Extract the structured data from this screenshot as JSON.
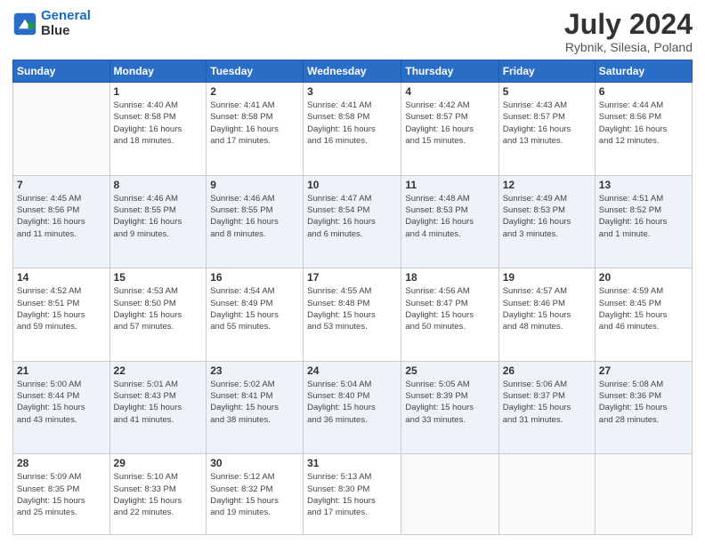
{
  "logo": {
    "line1": "General",
    "line2": "Blue"
  },
  "title": "July 2024",
  "subtitle": "Rybnik, Silesia, Poland",
  "header_days": [
    "Sunday",
    "Monday",
    "Tuesday",
    "Wednesday",
    "Thursday",
    "Friday",
    "Saturday"
  ],
  "weeks": [
    [
      {
        "day": "",
        "info": ""
      },
      {
        "day": "1",
        "info": "Sunrise: 4:40 AM\nSunset: 8:58 PM\nDaylight: 16 hours\nand 18 minutes."
      },
      {
        "day": "2",
        "info": "Sunrise: 4:41 AM\nSunset: 8:58 PM\nDaylight: 16 hours\nand 17 minutes."
      },
      {
        "day": "3",
        "info": "Sunrise: 4:41 AM\nSunset: 8:58 PM\nDaylight: 16 hours\nand 16 minutes."
      },
      {
        "day": "4",
        "info": "Sunrise: 4:42 AM\nSunset: 8:57 PM\nDaylight: 16 hours\nand 15 minutes."
      },
      {
        "day": "5",
        "info": "Sunrise: 4:43 AM\nSunset: 8:57 PM\nDaylight: 16 hours\nand 13 minutes."
      },
      {
        "day": "6",
        "info": "Sunrise: 4:44 AM\nSunset: 8:56 PM\nDaylight: 16 hours\nand 12 minutes."
      }
    ],
    [
      {
        "day": "7",
        "info": "Sunrise: 4:45 AM\nSunset: 8:56 PM\nDaylight: 16 hours\nand 11 minutes."
      },
      {
        "day": "8",
        "info": "Sunrise: 4:46 AM\nSunset: 8:55 PM\nDaylight: 16 hours\nand 9 minutes."
      },
      {
        "day": "9",
        "info": "Sunrise: 4:46 AM\nSunset: 8:55 PM\nDaylight: 16 hours\nand 8 minutes."
      },
      {
        "day": "10",
        "info": "Sunrise: 4:47 AM\nSunset: 8:54 PM\nDaylight: 16 hours\nand 6 minutes."
      },
      {
        "day": "11",
        "info": "Sunrise: 4:48 AM\nSunset: 8:53 PM\nDaylight: 16 hours\nand 4 minutes."
      },
      {
        "day": "12",
        "info": "Sunrise: 4:49 AM\nSunset: 8:53 PM\nDaylight: 16 hours\nand 3 minutes."
      },
      {
        "day": "13",
        "info": "Sunrise: 4:51 AM\nSunset: 8:52 PM\nDaylight: 16 hours\nand 1 minute."
      }
    ],
    [
      {
        "day": "14",
        "info": "Sunrise: 4:52 AM\nSunset: 8:51 PM\nDaylight: 15 hours\nand 59 minutes."
      },
      {
        "day": "15",
        "info": "Sunrise: 4:53 AM\nSunset: 8:50 PM\nDaylight: 15 hours\nand 57 minutes."
      },
      {
        "day": "16",
        "info": "Sunrise: 4:54 AM\nSunset: 8:49 PM\nDaylight: 15 hours\nand 55 minutes."
      },
      {
        "day": "17",
        "info": "Sunrise: 4:55 AM\nSunset: 8:48 PM\nDaylight: 15 hours\nand 53 minutes."
      },
      {
        "day": "18",
        "info": "Sunrise: 4:56 AM\nSunset: 8:47 PM\nDaylight: 15 hours\nand 50 minutes."
      },
      {
        "day": "19",
        "info": "Sunrise: 4:57 AM\nSunset: 8:46 PM\nDaylight: 15 hours\nand 48 minutes."
      },
      {
        "day": "20",
        "info": "Sunrise: 4:59 AM\nSunset: 8:45 PM\nDaylight: 15 hours\nand 46 minutes."
      }
    ],
    [
      {
        "day": "21",
        "info": "Sunrise: 5:00 AM\nSunset: 8:44 PM\nDaylight: 15 hours\nand 43 minutes."
      },
      {
        "day": "22",
        "info": "Sunrise: 5:01 AM\nSunset: 8:43 PM\nDaylight: 15 hours\nand 41 minutes."
      },
      {
        "day": "23",
        "info": "Sunrise: 5:02 AM\nSunset: 8:41 PM\nDaylight: 15 hours\nand 38 minutes."
      },
      {
        "day": "24",
        "info": "Sunrise: 5:04 AM\nSunset: 8:40 PM\nDaylight: 15 hours\nand 36 minutes."
      },
      {
        "day": "25",
        "info": "Sunrise: 5:05 AM\nSunset: 8:39 PM\nDaylight: 15 hours\nand 33 minutes."
      },
      {
        "day": "26",
        "info": "Sunrise: 5:06 AM\nSunset: 8:37 PM\nDaylight: 15 hours\nand 31 minutes."
      },
      {
        "day": "27",
        "info": "Sunrise: 5:08 AM\nSunset: 8:36 PM\nDaylight: 15 hours\nand 28 minutes."
      }
    ],
    [
      {
        "day": "28",
        "info": "Sunrise: 5:09 AM\nSunset: 8:35 PM\nDaylight: 15 hours\nand 25 minutes."
      },
      {
        "day": "29",
        "info": "Sunrise: 5:10 AM\nSunset: 8:33 PM\nDaylight: 15 hours\nand 22 minutes."
      },
      {
        "day": "30",
        "info": "Sunrise: 5:12 AM\nSunset: 8:32 PM\nDaylight: 15 hours\nand 19 minutes."
      },
      {
        "day": "31",
        "info": "Sunrise: 5:13 AM\nSunset: 8:30 PM\nDaylight: 15 hours\nand 17 minutes."
      },
      {
        "day": "",
        "info": ""
      },
      {
        "day": "",
        "info": ""
      },
      {
        "day": "",
        "info": ""
      }
    ]
  ]
}
